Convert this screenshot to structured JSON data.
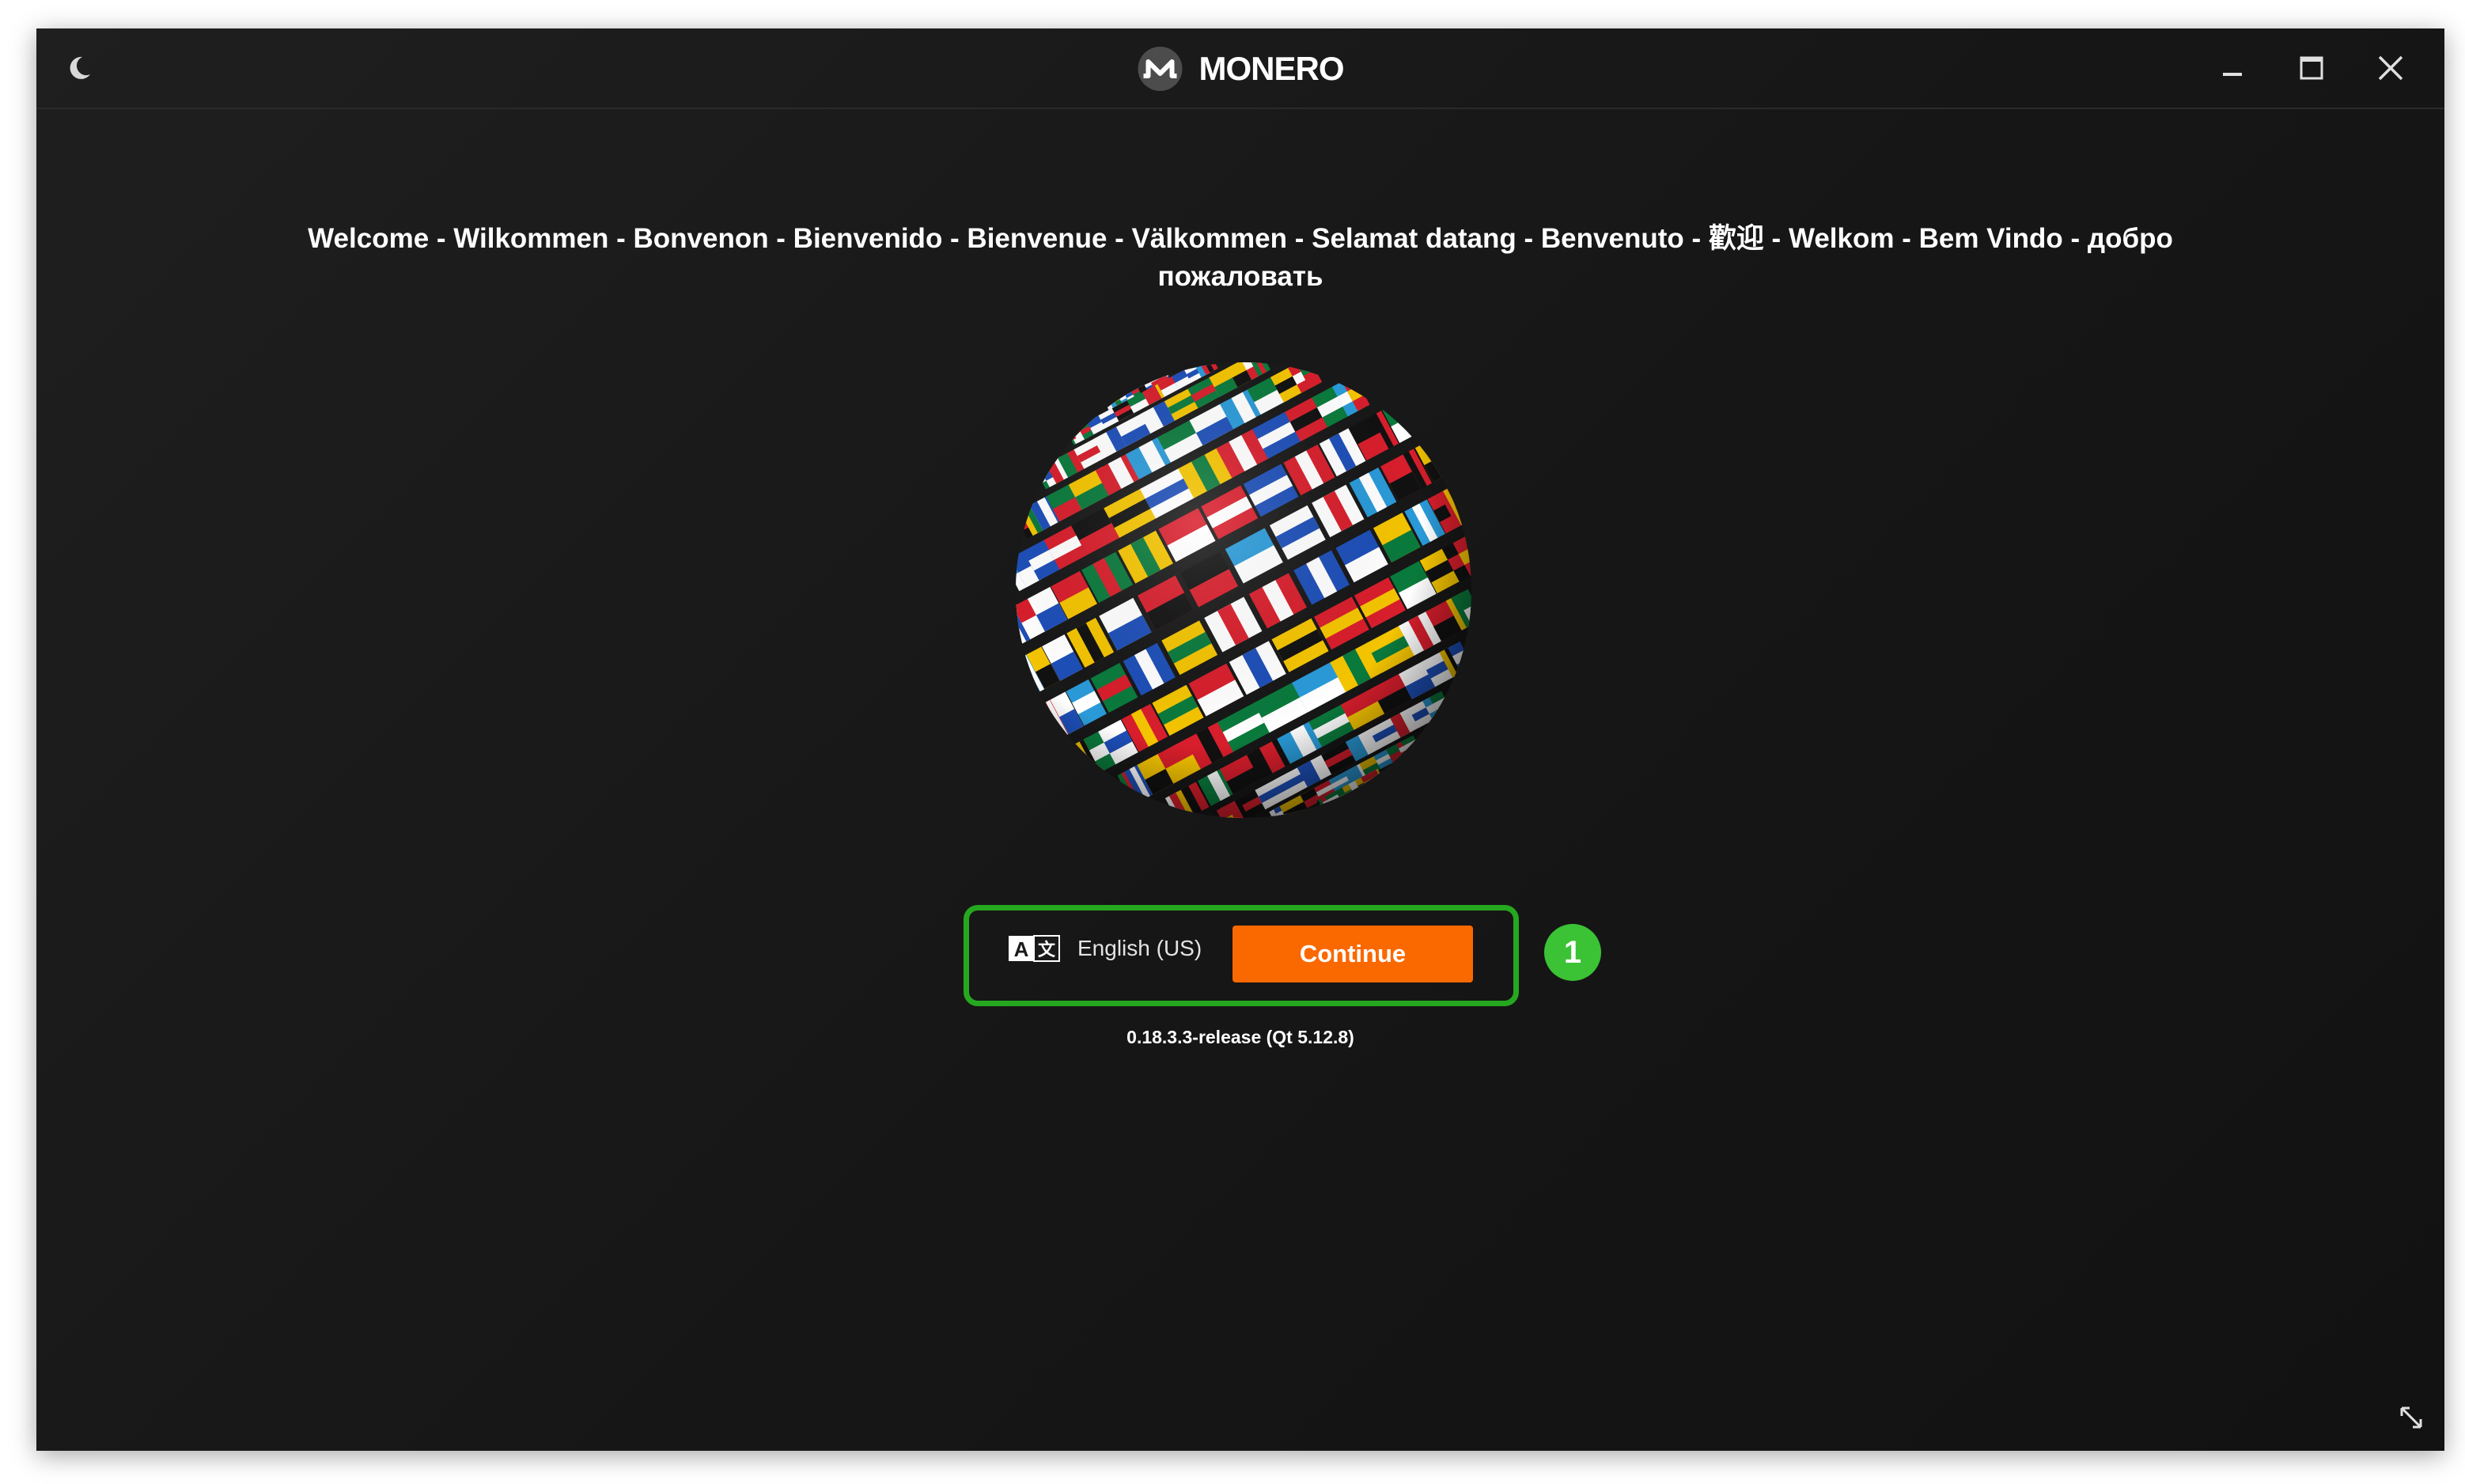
{
  "titlebar": {
    "theme_toggle_icon": "moon-icon",
    "app_name": "MONERO",
    "logo_icon": "monero-logo",
    "window_controls": [
      "minimize-icon",
      "maximize-icon",
      "close-icon"
    ]
  },
  "welcome": {
    "text": "Welcome - Wilkommen - Bonvenon - Bienvenido - Bienvenue - Välkommen - Selamat datang - Benvenuto - 歡迎 - Welkom - Bem Vindo - добро пожаловать"
  },
  "language": {
    "icon": "translate-icon",
    "selected": "English (US)"
  },
  "actions": {
    "continue_label": "Continue"
  },
  "annotation": {
    "step_number": "1"
  },
  "footer": {
    "version": "0.18.3.3-release (Qt 5.12.8)",
    "resize_icon": "resize-icon"
  },
  "colors": {
    "accent": "#fa6800",
    "highlight": "#25a81f",
    "badge": "#3bc235",
    "background": "#1a1a1a"
  }
}
